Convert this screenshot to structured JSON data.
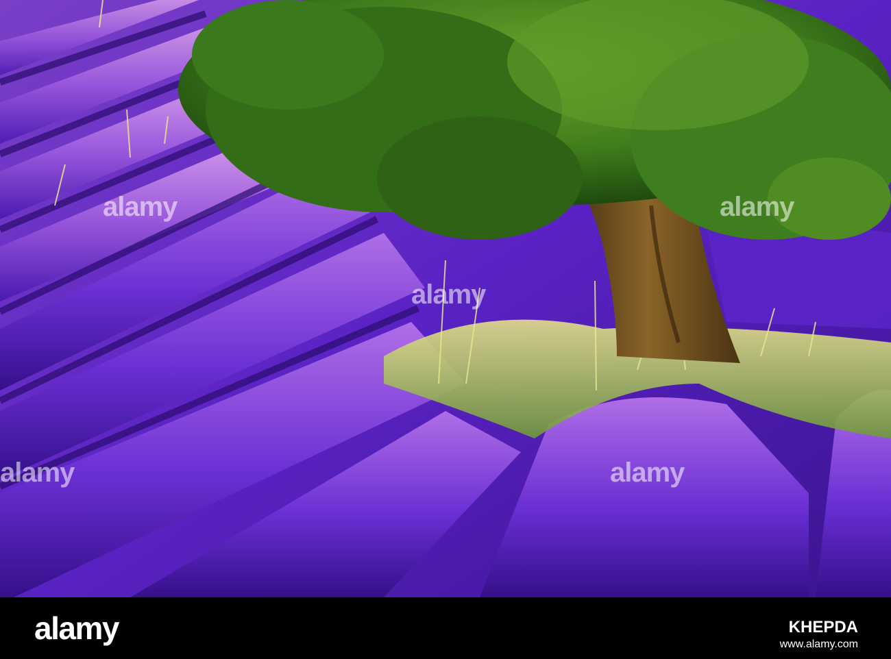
{
  "watermark": {
    "text": "alamy"
  },
  "footer": {
    "brand": "alamy",
    "image_id": "KHEPDA",
    "url": "www.alamy.com"
  },
  "colors": {
    "lavender_dark": "#3a148f",
    "lavender_mid": "#6a2fd4",
    "lavender_light": "#b878e6",
    "foliage": "#2f6d16",
    "trunk": "#6b4a1c",
    "grass": "#c9d77a",
    "footer_bg": "#000000"
  }
}
